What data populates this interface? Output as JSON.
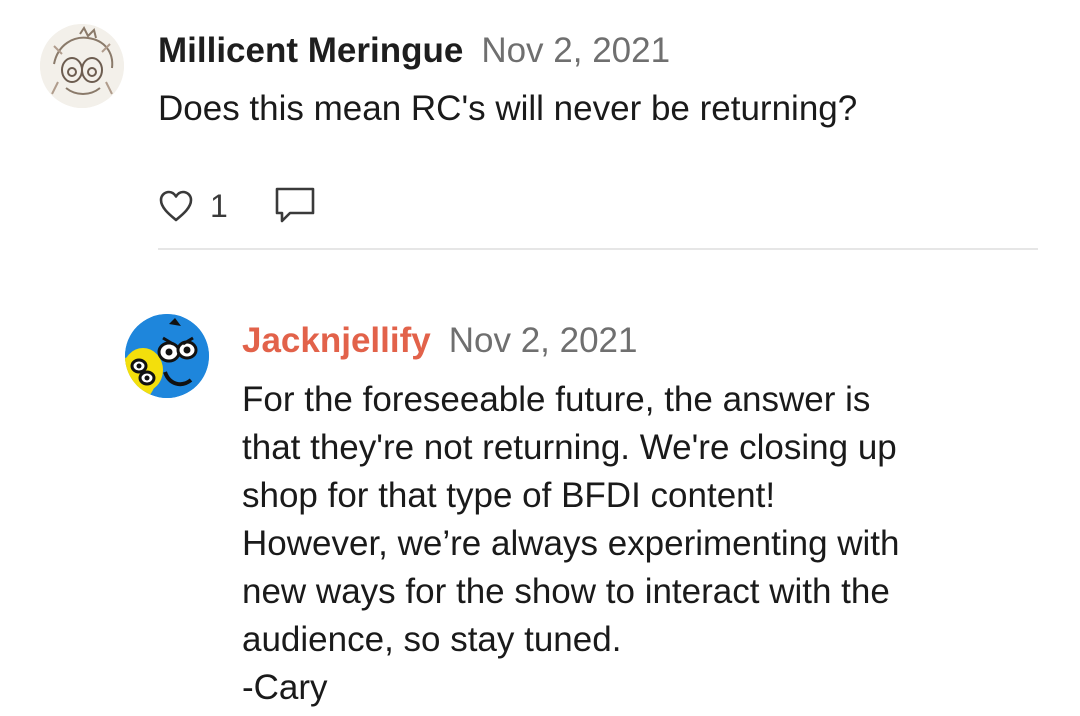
{
  "comments": [
    {
      "author": "Millicent Meringue",
      "date": "Nov 2, 2021",
      "body": [
        "Does this mean RC's will never be returning?"
      ],
      "likes": "1",
      "avatar_icon": "sketch-avatar-icon"
    },
    {
      "author": "Jacknjellify",
      "date": "Nov 2, 2021",
      "body": [
        "For the foreseeable future, the answer is",
        "that they're not returning. We're closing up",
        "shop for that type of BFDI content!",
        "However, we’re always experimenting with",
        "new ways for the show to interact with the",
        "audience, so stay tuned.",
        "-Cary"
      ],
      "avatar_icon": "cartoon-avatar-icon",
      "author_color": "#e2624a"
    }
  ],
  "icons": {
    "like": "heart-outline-icon",
    "reply": "speech-bubble-icon"
  }
}
